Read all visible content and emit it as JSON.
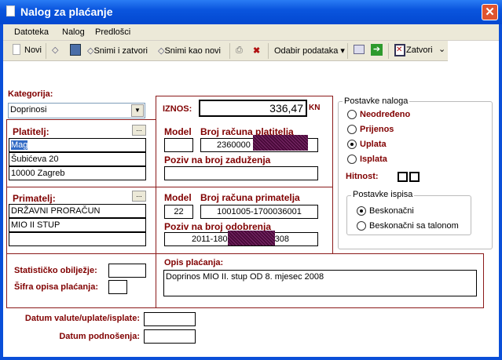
{
  "window": {
    "title": "Nalog za plaćanje",
    "close": "✕"
  },
  "menu": [
    "Datoteka",
    "Nalog",
    "Predlošci"
  ],
  "toolbar": {
    "new": "Novi",
    "save_close": "Snimi i zatvori",
    "save_new": "Snimi kao novi",
    "data_select": "Odabir podataka ▾",
    "close": "Zatvori",
    "more": "⌄"
  },
  "category": {
    "label": "Kategorija:",
    "value": "Doprinosi"
  },
  "amount": {
    "label": "IZNOS:",
    "value": "336,47",
    "currency": "KN"
  },
  "payer": {
    "label": "Platitelj:",
    "browse": "...",
    "lines": [
      "Mag",
      "Šubićeva 20",
      "10000 Zagreb"
    ],
    "model_label": "Model",
    "account_label": "Broj računa platitelja",
    "model": "",
    "account": "2360000",
    "ref_label": "Poziv na broj zaduženja",
    "ref": ""
  },
  "payee": {
    "label": "Primatelj:",
    "browse": "...",
    "lines": [
      "DRŽAVNI PRORAČUN",
      "MIO II STUP",
      ""
    ],
    "model_label": "Model",
    "account_label": "Broj računa primatelja",
    "model": "22",
    "account": "1001005-1700036001",
    "ref_label": "Poziv na broj odobrenja",
    "ref_start": "2011-180",
    "ref_end": "308"
  },
  "stat_label": "Statističko obilježje:",
  "code_label": "Šifra opisa plaćanja:",
  "stat": "",
  "code": "",
  "description": {
    "label": "Opis plaćanja:",
    "value": "Doprinos MIO II. stup OD 8. mjesec 2008"
  },
  "dates": {
    "value_label": "Datum valute/uplate/isplate:",
    "submit_label": "Datum podnošenja:",
    "value_date": "",
    "submit_date": ""
  },
  "order_settings": {
    "title": "Postavke naloga",
    "options": [
      "Neodređeno",
      "Prijenos",
      "Uplata",
      "Isplata"
    ],
    "selected": 2,
    "urgency_label": "Hitnost:"
  },
  "print_settings": {
    "title": "Postavke ispisa",
    "options": [
      "Beskonačni",
      "Beskonačni sa talonom"
    ],
    "selected": 0
  }
}
